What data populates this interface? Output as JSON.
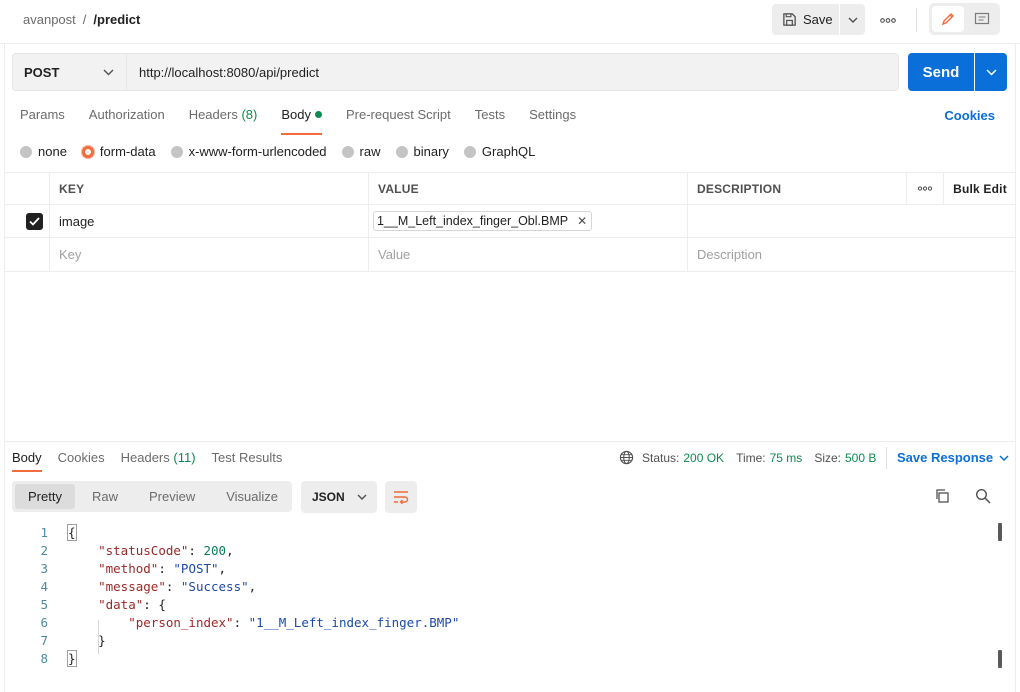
{
  "header": {
    "workspace": "avanpost",
    "separator": "/",
    "request_name": "/predict",
    "save_label": "Save"
  },
  "request": {
    "method": "POST",
    "url": "http://localhost:8080/api/predict",
    "send_label": "Send",
    "tabs": [
      {
        "label": "Params"
      },
      {
        "label": "Authorization"
      },
      {
        "label": "Headers",
        "count": "(8)"
      },
      {
        "label": "Body",
        "active": true
      },
      {
        "label": "Pre-request Script"
      },
      {
        "label": "Tests"
      },
      {
        "label": "Settings"
      }
    ],
    "cookies_label": "Cookies",
    "body_types": [
      "none",
      "form-data",
      "x-www-form-urlencoded",
      "raw",
      "binary",
      "GraphQL"
    ],
    "selected_body_type": "form-data"
  },
  "params_table": {
    "headers": {
      "key": "KEY",
      "value": "VALUE",
      "description": "DESCRIPTION",
      "bulk_edit": "Bulk Edit"
    },
    "rows": [
      {
        "checked": true,
        "key": "image",
        "value": "1__M_Left_index_finger_Obl.BMP",
        "description": ""
      }
    ],
    "placeholders": {
      "key": "Key",
      "value": "Value",
      "description": "Description"
    }
  },
  "response": {
    "tabs": [
      {
        "label": "Body",
        "active": true
      },
      {
        "label": "Cookies"
      },
      {
        "label": "Headers",
        "count": "(11)"
      },
      {
        "label": "Test Results"
      }
    ],
    "status_label": "Status:",
    "status_value": "200 OK",
    "time_label": "Time:",
    "time_value": "75 ms",
    "size_label": "Size:",
    "size_value": "500 B",
    "save_response_label": "Save Response",
    "views": [
      "Pretty",
      "Raw",
      "Preview",
      "Visualize"
    ],
    "active_view": "Pretty",
    "format": "JSON",
    "line_numbers": [
      "1",
      "2",
      "3",
      "4",
      "5",
      "6",
      "7",
      "8"
    ],
    "code": {
      "open": "{",
      "k_status": "\"statusCode\"",
      "v_status": "200",
      "k_method": "\"method\"",
      "v_method": "\"POST\"",
      "k_message": "\"message\"",
      "v_message": "\"Success\"",
      "k_data": "\"data\"",
      "k_person": "\"person_index\"",
      "v_person": "\"1__M_Left_index_finger.BMP\"",
      "close_inner": "}",
      "close": "}"
    }
  },
  "colors": {
    "accent": "#f26b3a",
    "primary": "#0a6fd8",
    "success": "#0d8a4f"
  }
}
